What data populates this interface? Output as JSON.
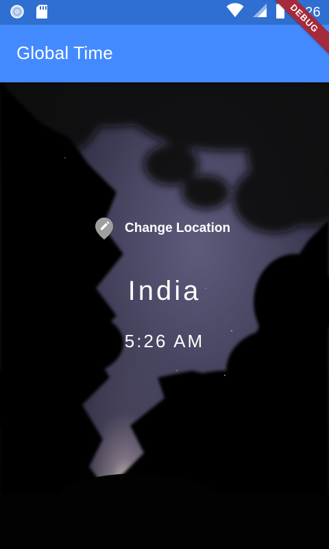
{
  "status_bar": {
    "time": "5:26",
    "icons": [
      "sync-icon",
      "sd-card-icon",
      "wifi-icon",
      "cell-signal-icon",
      "battery-icon"
    ],
    "color": "#2f6fd1"
  },
  "app_bar": {
    "title": "Global Time",
    "color": "#448aff"
  },
  "debug_banner": {
    "label": "DEBUG",
    "color": "#a52a3c"
  },
  "main": {
    "change_location_label": "Change Location",
    "location_icon": "edit-location-icon",
    "location_name": "India",
    "time": "5:26 AM"
  }
}
